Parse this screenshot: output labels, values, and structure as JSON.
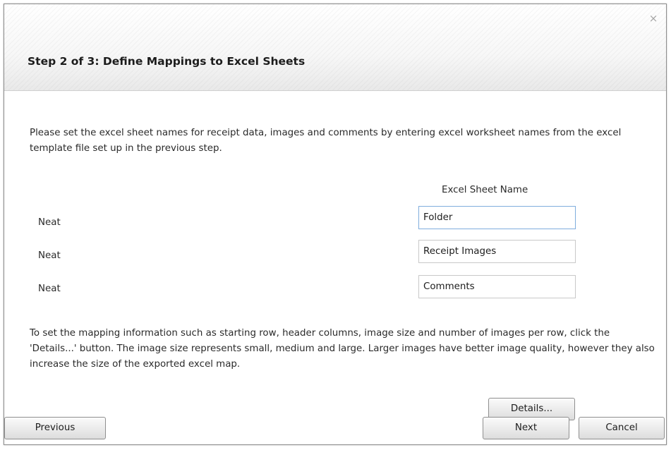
{
  "dialog": {
    "close_symbol": "×",
    "title": "Step 2 of 3: Define Mappings to Excel Sheets",
    "intro_text": "Please set the excel sheet names for receipt data, images and comments by entering excel worksheet names from the excel template file set up in the previous step.",
    "column_header": "Excel Sheet Name",
    "rows": [
      {
        "label": "Neat",
        "value": "Folder"
      },
      {
        "label": "Neat",
        "value": "Receipt Images"
      },
      {
        "label": "Neat",
        "value": "Comments"
      }
    ],
    "details_text": "To set the mapping information such as starting row, header columns, image size and number of images per row, click the 'Details...' button. The image size represents small, medium and large. Larger images have better image quality, however they also increase the size of the exported excel map.",
    "buttons": {
      "details": "Details...",
      "previous": "Previous",
      "next": "Next",
      "cancel": "Cancel"
    }
  }
}
